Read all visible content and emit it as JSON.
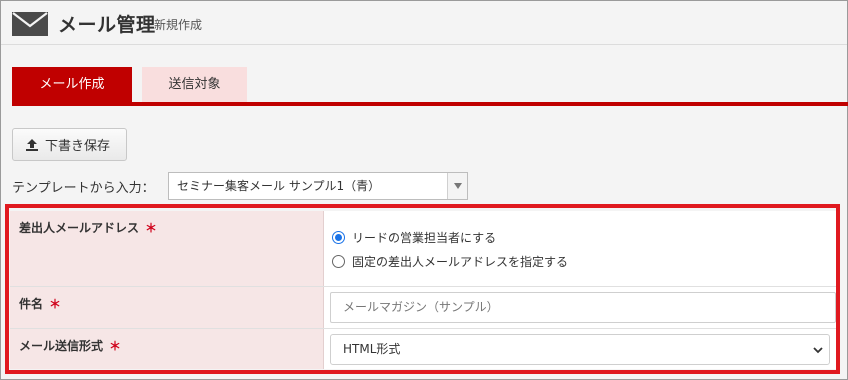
{
  "header": {
    "title": "メール管理",
    "subtitle": "新規作成",
    "icon": "mail-icon"
  },
  "tabs": [
    {
      "label": "メール作成",
      "active": true
    },
    {
      "label": "送信対象",
      "active": false
    }
  ],
  "toolbar": {
    "draft_label": "下書き保存",
    "draft_icon": "upload-icon"
  },
  "template": {
    "label": "テンプレートから入力：",
    "selected": "セミナー集客メール サンプル1（青）"
  },
  "form": {
    "sender": {
      "label": "差出人メールアドレス",
      "required": "＊",
      "options": [
        {
          "label": "リードの営業担当者にする",
          "checked": true
        },
        {
          "label": "固定の差出人メールアドレスを指定する",
          "checked": false
        }
      ]
    },
    "subject": {
      "label": "件名",
      "required": "＊",
      "value": "メールマガジン（サンプル）"
    },
    "format": {
      "label": "メール送信形式",
      "required": "＊",
      "selected": "HTML形式"
    }
  },
  "colors": {
    "accent": "#c00000",
    "highlight": "#e0191f",
    "label_bg": "#f6e6e6",
    "tab_inactive_bg": "#f9dede"
  }
}
